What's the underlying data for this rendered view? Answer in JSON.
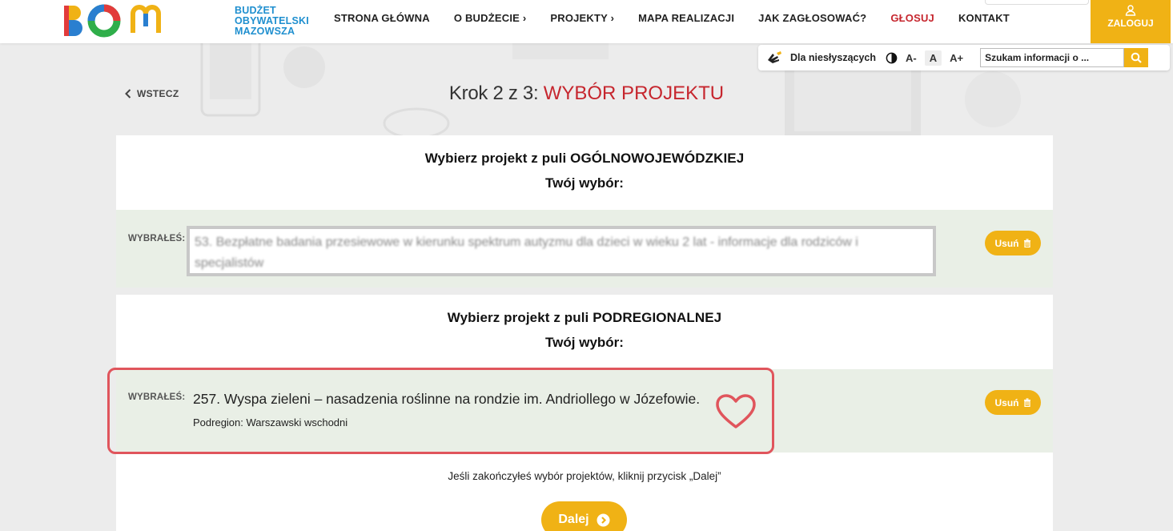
{
  "logo": {
    "line1": "BUDŻET",
    "line2": "OBYWATELSKI",
    "line3": "MAZOWSZA"
  },
  "nav": {
    "items": [
      {
        "label": "STRONA GŁÓWNA"
      },
      {
        "label": "O BUDŻECIE ›"
      },
      {
        "label": "PROJEKTY ›"
      },
      {
        "label": "MAPA REALIZACJI"
      },
      {
        "label": "JAK ZAGŁOSOWAĆ?"
      },
      {
        "label": "GŁOSUJ"
      },
      {
        "label": "KONTAKT"
      }
    ],
    "login_label": "ZALOGUJ"
  },
  "a11y": {
    "deaf_label": "Dla niesłyszących",
    "font_small": "A-",
    "font_normal": "A",
    "font_large": "A+",
    "search_value": "Szukam informacji o ..."
  },
  "step": {
    "back_label": "WSTECZ",
    "prefix": "Krok 2 z 3: ",
    "title": "WYBÓR PROJEKTU"
  },
  "pool1": {
    "heading": "Wybierz projekt z puli OGÓLNOWOJEWÓDZKIEJ",
    "choice_heading": "Twój wybór:",
    "choice_label": "WYBRAŁEŚ:",
    "blurred_text": "53. Bezpłatne badania przesiewowe w kierunku spektrum autyzmu dla dzieci w wieku 2 lat - informacje dla rodziców i specjalistów",
    "remove_label": "Usuń"
  },
  "pool2": {
    "heading": "Wybierz projekt z puli PODREGIONALNEJ",
    "choice_heading": "Twój wybór:",
    "choice_label": "WYBRAŁEŚ:",
    "project_title": "257. Wyspa zieleni – nasadzenia roślinne na rondzie im. Andriollego w Józefowie.",
    "subregion": "Podregion: Warszawski wschodni",
    "remove_label": "Usuń"
  },
  "footer": {
    "finish_text": "Jeśli zakończyłeś wybór projektów, kliknij przycisk „Dalej”",
    "next_label": "Dalej"
  },
  "colors": {
    "accent": "#f0b215",
    "active_nav": "#c6262e",
    "highlight_frame": "#e0555c",
    "choice_bg": "#e9efe6"
  }
}
